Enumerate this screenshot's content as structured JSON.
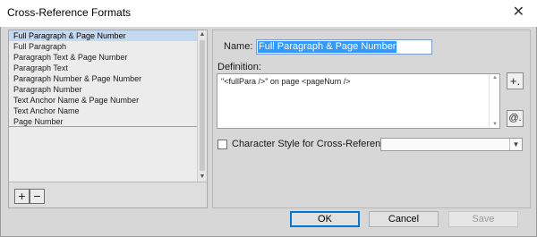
{
  "window": {
    "title": "Cross-Reference Formats",
    "close_glyph": "✕"
  },
  "formats_list": {
    "items": [
      "Full Paragraph & Page Number",
      "Full Paragraph",
      "Paragraph Text & Page Number",
      "Paragraph Text",
      "Paragraph Number & Page Number",
      "Paragraph Number",
      "Text Anchor Name & Page Number",
      "Text Anchor Name",
      "Page Number"
    ],
    "selected_index": 0,
    "add_glyph": "+",
    "remove_glyph": "−"
  },
  "editor": {
    "name_label": "Name:",
    "name_value": "Full Paragraph & Page Number",
    "definition_label": "Definition:",
    "definition_value": "\"<fullPara />\" on page <pageNum />",
    "insert_special_glyph": "+.",
    "insert_text_var_glyph": "@."
  },
  "character_style": {
    "label": "Character Style for Cross-Reference:",
    "checked": false,
    "selected_value": ""
  },
  "buttons": {
    "ok": "OK",
    "cancel": "Cancel",
    "save": "Save"
  },
  "colors": {
    "selection": "#c3d9f0",
    "text_selection": "#3399ff",
    "dialog_bg": "#d7d7d7"
  }
}
